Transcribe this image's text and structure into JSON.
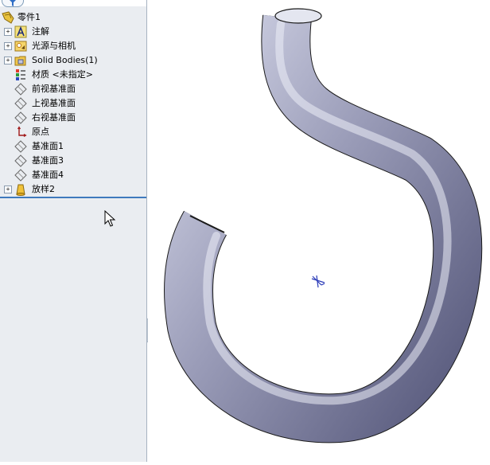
{
  "tree": {
    "root_label": "零件1",
    "items": [
      {
        "label": "注解",
        "icon": "annotations-icon",
        "expandable": true
      },
      {
        "label": "光源与相机",
        "icon": "lights-cameras-icon",
        "expandable": true
      },
      {
        "label": "Solid Bodies(1)",
        "icon": "solid-bodies-folder-icon",
        "expandable": true
      },
      {
        "label": "材质 <未指定>",
        "icon": "material-icon",
        "expandable": false
      },
      {
        "label": "前视基准面",
        "icon": "plane-icon",
        "expandable": false
      },
      {
        "label": "上视基准面",
        "icon": "plane-icon",
        "expandable": false
      },
      {
        "label": "右视基准面",
        "icon": "plane-icon",
        "expandable": false
      },
      {
        "label": "原点",
        "icon": "origin-icon",
        "expandable": false
      },
      {
        "label": "基准面1",
        "icon": "plane-icon",
        "expandable": false
      },
      {
        "label": "基准面3",
        "icon": "plane-icon",
        "expandable": false
      },
      {
        "label": "基准面4",
        "icon": "plane-icon",
        "expandable": false
      },
      {
        "label": "放样2",
        "icon": "loft-icon",
        "expandable": true
      }
    ],
    "expand_glyph": "+"
  },
  "colors": {
    "panel_bg": "#eaedf1",
    "rollback_bar": "#3f79bd",
    "model_mid": "#9a9cb8",
    "origin_marker": "#2b3bb8"
  }
}
